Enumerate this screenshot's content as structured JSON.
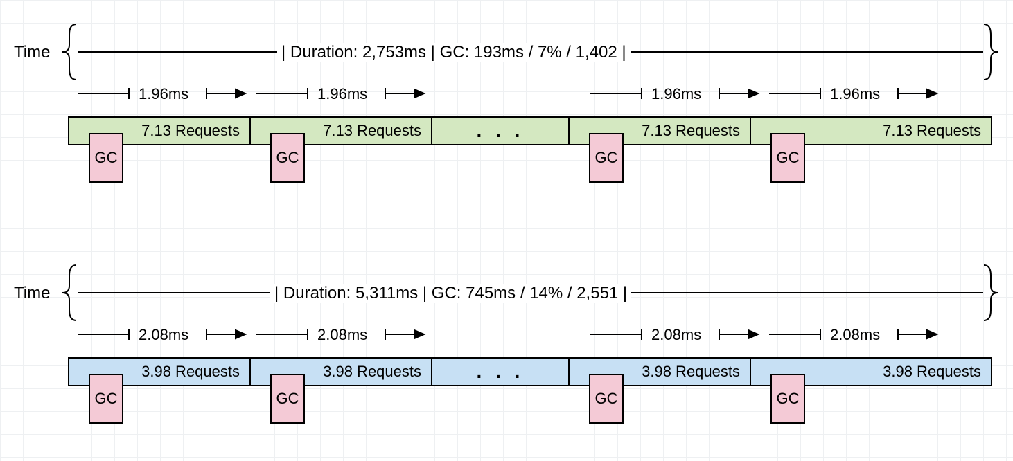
{
  "rows": [
    {
      "time_label": "Time",
      "summary": "| Duration: 2,753ms | GC: 193ms / 7% / 1,402 |",
      "tick_label": "1.96ms",
      "requests_label": "7.13 Requests",
      "gc_label": "GC",
      "ellipsis": ". . .",
      "color_class": "req-green"
    },
    {
      "time_label": "Time",
      "summary": "| Duration: 5,311ms | GC: 745ms / 14% / 2,551 |",
      "tick_label": "2.08ms",
      "requests_label": "3.98 Requests",
      "gc_label": "GC",
      "ellipsis": ". . .",
      "color_class": "req-blue"
    }
  ],
  "chart_data": [
    {
      "type": "table",
      "title": "Run 1 timing",
      "duration_ms": 2753,
      "gc_time_ms": 193,
      "gc_percent": 7,
      "gc_count": 1402,
      "avg_gc_interval_ms": 1.96,
      "requests_per_gc": 7.13
    },
    {
      "type": "table",
      "title": "Run 2 timing",
      "duration_ms": 5311,
      "gc_time_ms": 745,
      "gc_percent": 14,
      "gc_count": 2551,
      "avg_gc_interval_ms": 2.08,
      "requests_per_gc": 3.98
    }
  ]
}
